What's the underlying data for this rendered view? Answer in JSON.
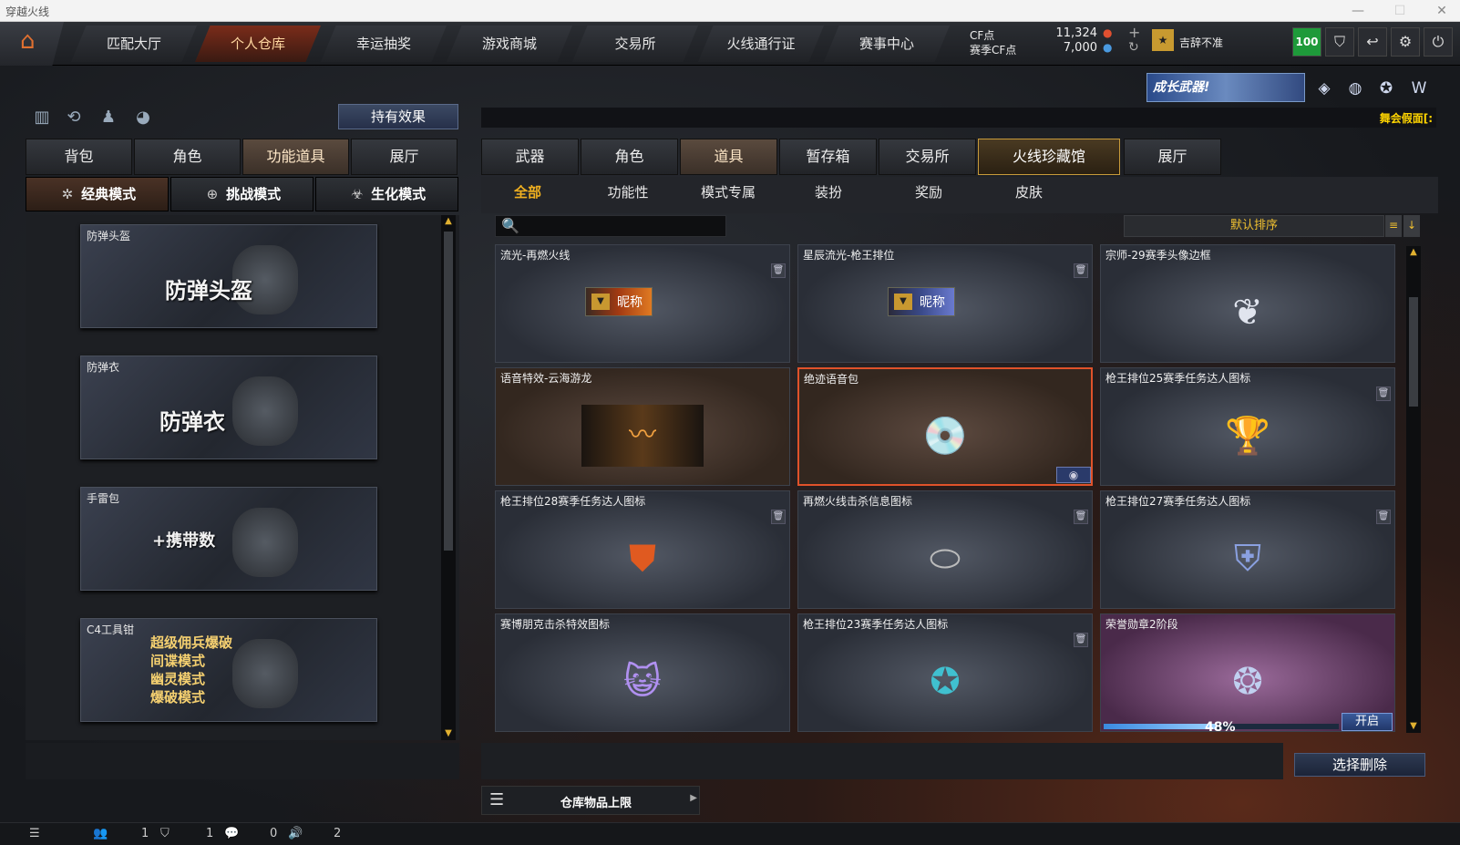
{
  "window": {
    "title": "穿越火线"
  },
  "nav": {
    "tabs": [
      "匹配大厅",
      "个人仓库",
      "幸运抽奖",
      "游戏商城",
      "交易所",
      "火线通行证",
      "赛事中心"
    ],
    "active_index": 1
  },
  "currency": {
    "cf_label": "CF点",
    "cf_value": "11,324",
    "match_cf_label": "赛季CF点",
    "match_cf_value": "7,000"
  },
  "user": {
    "name": "吉辞不准",
    "level_badge": "100"
  },
  "left": {
    "effect_button": "持有效果",
    "tabs": [
      "背包",
      "角色",
      "功能道具",
      "展厅"
    ],
    "active_tab": 2,
    "modes": [
      "经典模式",
      "挑战模式",
      "生化模式"
    ],
    "items": [
      {
        "label": "防弹头盔",
        "big": "防弹头盔"
      },
      {
        "label": "防弹衣",
        "big": "防弹衣"
      },
      {
        "label": "手雷包",
        "big": "+携带数"
      },
      {
        "label": "C4工具钳",
        "lines": [
          "超级佣兵爆破",
          "间谍模式",
          "幽灵模式",
          "爆破模式"
        ]
      }
    ]
  },
  "right": {
    "promo": "成长武器!",
    "ticker": "舞会假面[:",
    "tabs": [
      "武器",
      "角色",
      "道具",
      "暂存箱",
      "交易所",
      "火线珍藏馆",
      "展厅"
    ],
    "active_tab": 2,
    "sub_tabs": [
      "全部",
      "功能性",
      "模式专属",
      "装扮",
      "奖励",
      "皮肤"
    ],
    "active_sub": 0,
    "search_placeholder": "",
    "sort_label": "默认排序",
    "cards": [
      {
        "title": "流光-再燃火线",
        "badge": "昵称"
      },
      {
        "title": "星辰流光-枪王排位",
        "badge": "昵称"
      },
      {
        "title": "宗师-29赛季头像边框"
      },
      {
        "title": "语音特效-云海游龙"
      },
      {
        "title": "绝迹语音包"
      },
      {
        "title": "枪王排位25赛季任务达人图标"
      },
      {
        "title": "枪王排位28赛季任务达人图标"
      },
      {
        "title": "再燃火线击杀信息图标"
      },
      {
        "title": "枪王排位27赛季任务达人图标"
      },
      {
        "title": "赛博朋克击杀特效图标"
      },
      {
        "title": "枪王排位23赛季任务达人图标"
      },
      {
        "title": "荣誉勋章2阶段",
        "progress": "48%",
        "open_label": "开启"
      }
    ],
    "delete_button": "选择删除",
    "capacity_label": "仓库物品上限"
  },
  "status": {
    "friends": "1",
    "clan": "1",
    "chat": "0",
    "voice": "2"
  },
  "colors": {
    "accent": "#f0b020",
    "selected_border": "#e0522a"
  }
}
